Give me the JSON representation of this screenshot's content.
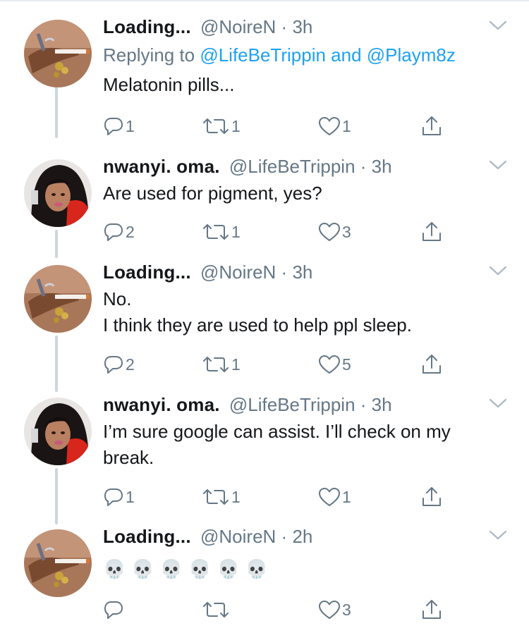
{
  "tweets": [
    {
      "name": "Loading...",
      "handle": "@NoireN",
      "separator": "·",
      "time": "3h",
      "reply_prefix": "Replying to ",
      "reply_mention_1": "@LifeBeTrippin",
      "reply_join": " and ",
      "reply_mention_2": "@Playm8z",
      "text_lines": [
        "Melatonin pills..."
      ],
      "reply_count": "1",
      "retweet_count": "1",
      "like_count": "1",
      "avatar": "smoking-hand-avatar"
    },
    {
      "name": "nwanyi. oma.",
      "handle": "@LifeBeTrippin",
      "separator": "·",
      "time": "3h",
      "text_lines": [
        "Are used for pigment, yes?"
      ],
      "reply_count": "2",
      "retweet_count": "1",
      "like_count": "3",
      "avatar": "portrait-avatar"
    },
    {
      "name": "Loading...",
      "handle": "@NoireN",
      "separator": "·",
      "time": "3h",
      "text_lines": [
        "No.",
        "I think they are used to help ppl sleep."
      ],
      "reply_count": "2",
      "retweet_count": "1",
      "like_count": "5",
      "avatar": "smoking-hand-avatar"
    },
    {
      "name": "nwanyi. oma.",
      "handle": "@LifeBeTrippin",
      "separator": "·",
      "time": "3h",
      "text_lines": [
        "I’m sure google can assist. I’ll check on my",
        "break."
      ],
      "reply_count": "1",
      "retweet_count": "1",
      "like_count": "1",
      "avatar": "portrait-avatar"
    },
    {
      "name": "Loading...",
      "handle": "@NoireN",
      "separator": "·",
      "time": "2h",
      "text_lines": [
        "💀💀💀💀💀💀"
      ],
      "reply_count": "",
      "retweet_count": "",
      "like_count": "3",
      "avatar": "smoking-hand-avatar"
    }
  ],
  "colors": {
    "text": "#14171a",
    "muted": "#657786",
    "link": "#1da1f2",
    "thread_line": "#ccd6dd"
  }
}
